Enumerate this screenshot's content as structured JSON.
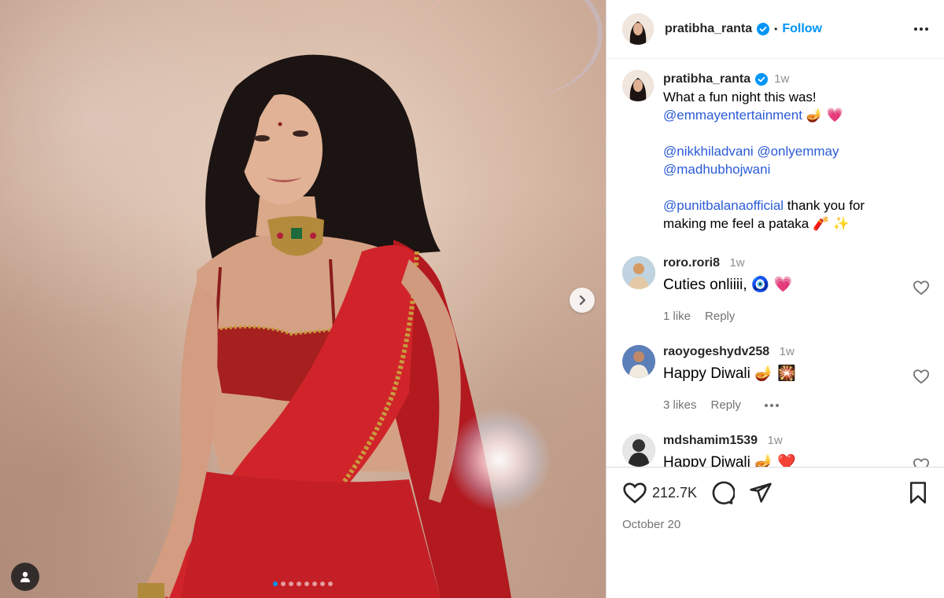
{
  "post": {
    "image_alt": "Photo of a woman in a red saree with an embellished blouse and a green-stone choker",
    "carousel": {
      "count": 8,
      "active_index": 0
    }
  },
  "header": {
    "username": "pratibha_ranta",
    "separator": "•",
    "follow_label": "Follow"
  },
  "caption": {
    "username": "pratibha_ranta",
    "time": "1w",
    "line1": "What a fun night this was!",
    "mention1": "@emmayentertainment",
    "emoji1": "🪔 💗",
    "mention2": "@nikkhiladvani",
    "mention3": "@onlyemmay",
    "mention4": "@madhubhojwani",
    "mention5": "@punitbalanaofficial",
    "text5": " thank you for making me feel a pataka ",
    "emoji5": "🧨 ✨"
  },
  "comments": [
    {
      "username": "roro.rori8",
      "time": "1w",
      "text": "Cuties onliiii, 🧿 💗",
      "likes": "1 like",
      "reply": "Reply",
      "avatar_color": "#c9b89a"
    },
    {
      "username": "raoyogeshydv258",
      "time": "1w",
      "text": "Happy Diwali 🪔 🎇",
      "likes": "3 likes",
      "reply": "Reply",
      "avatar_color": "#5b7fb8"
    },
    {
      "username": "mdshamim1539",
      "time": "1w",
      "text": "Happy Diwali 🪔 ❤️",
      "likes": "",
      "reply": "",
      "avatar_color": "#3a3a3a"
    }
  ],
  "actions": {
    "like_count": "212.7K",
    "date": "October 20"
  },
  "colors": {
    "accent": "#0095f6",
    "verified": "#0095f6",
    "mention": "#2a5bd7",
    "text": "#262626",
    "muted": "#737373"
  }
}
